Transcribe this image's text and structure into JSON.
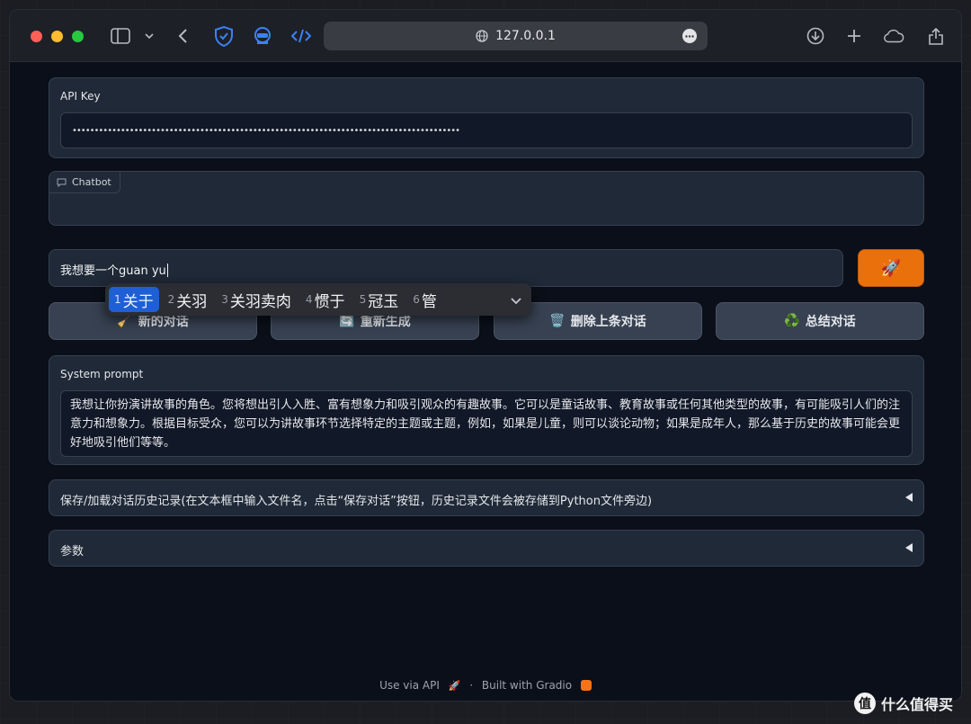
{
  "browser": {
    "url": "127.0.0.1"
  },
  "api_key": {
    "label": "API Key",
    "value": "••••••••••••••••••••••••••••••••••••••••••••••••••••••••••••••••••••••••••••••••••••••••"
  },
  "chatbot": {
    "label": "Chatbot"
  },
  "message_input": {
    "value": "我想要一个guan yu"
  },
  "send_button": {
    "icon": "rocket-icon",
    "glyph": "🚀"
  },
  "ime": {
    "candidates": [
      {
        "num": "1",
        "text": "关于"
      },
      {
        "num": "2",
        "text": "关羽"
      },
      {
        "num": "3",
        "text": "关羽卖肉"
      },
      {
        "num": "4",
        "text": "惯于"
      },
      {
        "num": "5",
        "text": "冠玉"
      },
      {
        "num": "6",
        "text": "管"
      }
    ]
  },
  "buttons": {
    "new_chat": "新的对话",
    "regenerate": "重新生成",
    "delete_last": "删除上条对话",
    "summarize": "总结对话"
  },
  "system_prompt": {
    "label": "System prompt",
    "value": "我想让你扮演讲故事的角色。您将想出引人入胜、富有想象力和吸引观众的有趣故事。它可以是童话故事、教育故事或任何其他类型的故事，有可能吸引人们的注意力和想象力。根据目标受众，您可以为讲故事环节选择特定的主题或主题，例如，如果是儿童，则可以谈论动物；如果是成年人，那么基于历史的故事可能会更好地吸引他们等等。"
  },
  "accordions": {
    "save_load": "保存/加载对话历史记录(在文本框中输入文件名，点击“保存对话”按钮，历史记录文件会被存储到Python文件旁边)",
    "params": "参数"
  },
  "footer": {
    "use_via_api": "Use via API",
    "dot": "·",
    "built_with": "Built with Gradio"
  },
  "watermark": {
    "logo": "值",
    "text": "什么值得买"
  },
  "colors": {
    "accent": "#ea700c",
    "ime_selected": "#1f5fd6"
  }
}
